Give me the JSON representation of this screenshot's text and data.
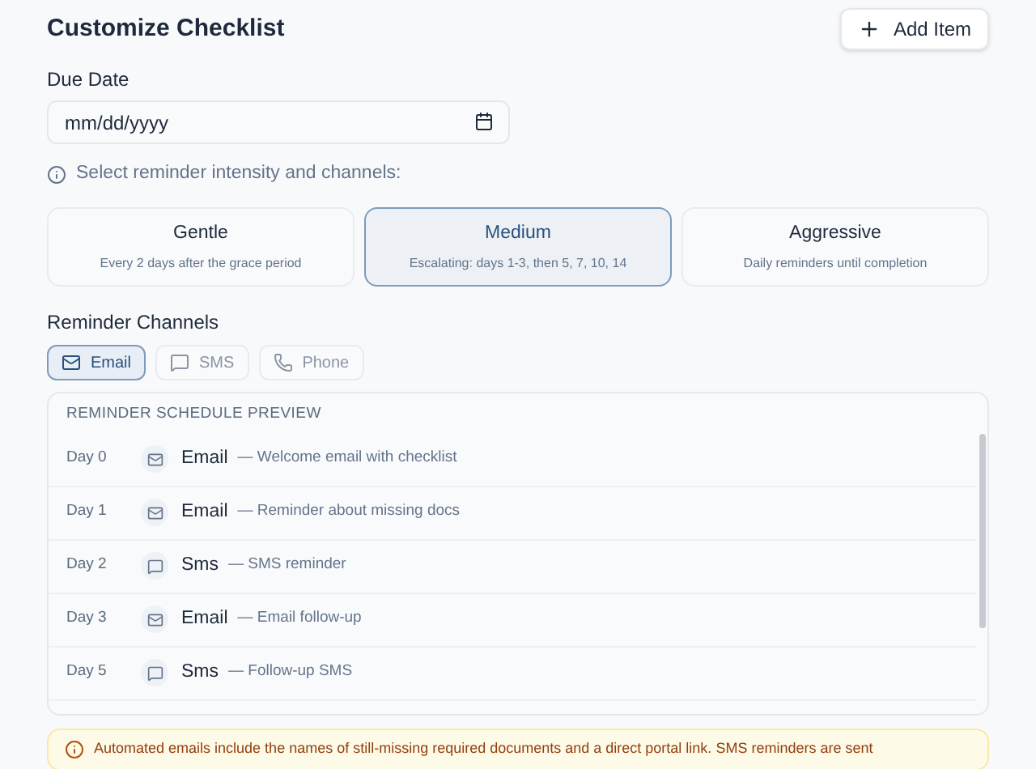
{
  "title": "Customize Checklist",
  "add_button": {
    "label": "Add Item"
  },
  "due_date": {
    "label": "Due Date",
    "placeholder": "mm/dd/yyyy"
  },
  "hint": "Select reminder intensity and channels:",
  "intensities": [
    {
      "name": "Gentle",
      "description": "Every 2 days after the grace period",
      "selected": false
    },
    {
      "name": "Medium",
      "description": "Escalating: days 1-3, then 5, 7, 10, 14",
      "selected": true
    },
    {
      "name": "Aggressive",
      "description": "Daily reminders until completion",
      "selected": false
    }
  ],
  "channels_label": "Reminder Channels",
  "channels": [
    {
      "kind": "email",
      "label": "Email",
      "selected": true
    },
    {
      "kind": "sms",
      "label": "SMS",
      "selected": false
    },
    {
      "kind": "phone",
      "label": "Phone",
      "selected": false
    }
  ],
  "schedule": {
    "heading": "REMINDER SCHEDULE PREVIEW",
    "rows": [
      {
        "day": "Day 0",
        "kind": "email",
        "channel": "Email",
        "note": "— Welcome email with checklist"
      },
      {
        "day": "Day 1",
        "kind": "email",
        "channel": "Email",
        "note": "— Reminder about missing docs"
      },
      {
        "day": "Day 2",
        "kind": "sms",
        "channel": "Sms",
        "note": "— SMS reminder"
      },
      {
        "day": "Day 3",
        "kind": "email",
        "channel": "Email",
        "note": "— Email follow-up"
      },
      {
        "day": "Day 5",
        "kind": "sms",
        "channel": "Sms",
        "note": "— Follow-up SMS"
      }
    ]
  },
  "notice": "Automated emails include the names of still-missing required documents and a direct portal link. SMS reminders are sent"
}
